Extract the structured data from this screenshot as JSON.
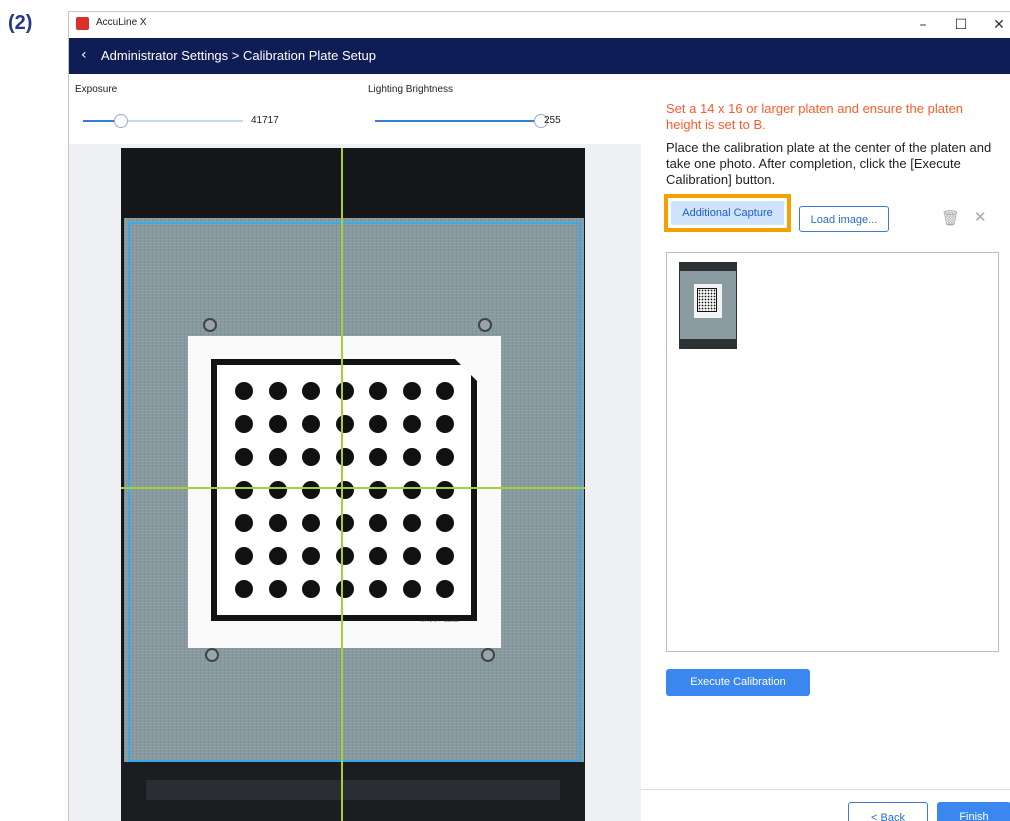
{
  "step_label": "(2)",
  "window": {
    "title": "AccuLine X",
    "minimize": "–",
    "maximize": "☐",
    "close": "✕"
  },
  "header": {
    "back_icon": "chevron-left-icon",
    "breadcrumb": "Administrator Settings > Calibration Plate Setup"
  },
  "controls": {
    "exposure": {
      "label": "Exposure",
      "value": "41717",
      "fraction": 0.24
    },
    "brightness": {
      "label": "Lighting Brightness",
      "value": "255",
      "fraction": 1.0
    }
  },
  "right": {
    "warning": "Set a 14 x 16 or larger platen and ensure the platen height is set to B.",
    "instruction": "Place the calibration plate at the center of the platen and take one photo. After completion, click the [Execute Calibration] button.",
    "additional_capture": "Additional Capture",
    "load_image": "Load image...",
    "delete_icon": "trash-icon",
    "clear_icon": "close-icon",
    "execute": "Execute Calibration"
  },
  "plate": {
    "serial": "TYF-0.5 / CAL8X8"
  },
  "footer": {
    "back": "< Back",
    "finish": "Finish"
  },
  "colors": {
    "header_bg": "#0f1d56",
    "accent": "#3a87f0",
    "warning": "#ff5a2c",
    "highlight": "#f3a000",
    "crosshair": "#a3d13a",
    "roi": "#37a9e8"
  }
}
